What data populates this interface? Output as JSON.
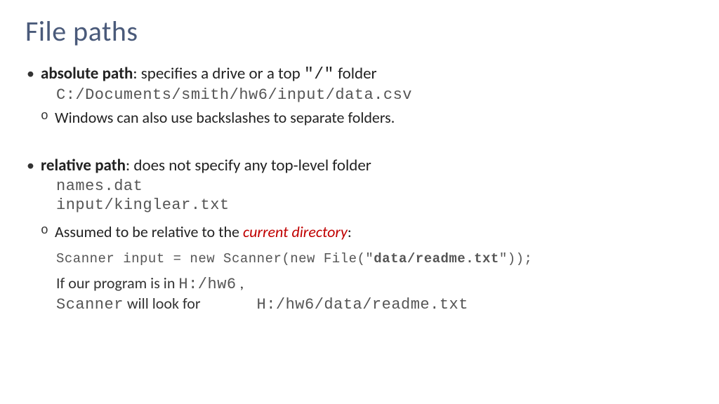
{
  "title": "File paths",
  "bullet1": {
    "term": "absolute path",
    "desc_a": ": specifies a drive or a top ",
    "desc_code": "\"/\"",
    "desc_b": " folder",
    "example": "C:/Documents/smith/hw6/input/data.csv",
    "sub1": "Windows can also use backslashes to separate folders."
  },
  "bullet2": {
    "term": "relative path",
    "desc": ": does not specify any top-level folder",
    "example1": "names.dat",
    "example2": "input/kinglear.txt",
    "sub_a": "Assumed to be relative to the ",
    "sub_em": "current directory",
    "sub_b": ":",
    "code_a": "Scanner input = new Scanner(new File(\"",
    "code_bold": "data/readme.txt",
    "code_b": "\"));",
    "tail1_a": "If our program is in  ",
    "tail1_code": "H:/hw6",
    "tail1_b": " ,",
    "tail2_a": "Scanner",
    "tail2_b": " will look for",
    "tail2_code": "H:/hw6/data/readme.txt"
  }
}
